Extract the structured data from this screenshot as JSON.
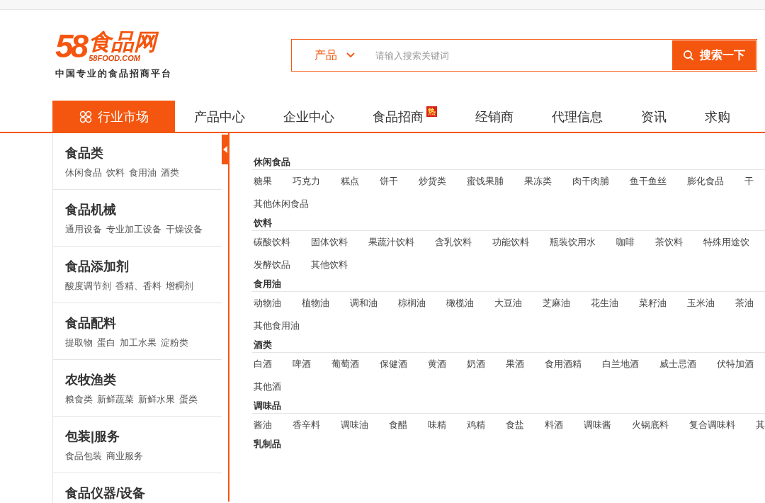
{
  "logo": {
    "number": "58",
    "name": "食品网",
    "domain": "58FOOD.COM",
    "tagline": "中国专业的食品招商平台"
  },
  "search": {
    "category": "产品",
    "placeholder": "请输入搜索关键词",
    "button": "搜索一下"
  },
  "nav": [
    {
      "label": "行业市场",
      "selected": true,
      "hot": false
    },
    {
      "label": "产品中心",
      "selected": false,
      "hot": false
    },
    {
      "label": "企业中心",
      "selected": false,
      "hot": false
    },
    {
      "label": "食品招商",
      "selected": false,
      "hot": true,
      "badge": "热"
    },
    {
      "label": "经销商",
      "selected": false,
      "hot": false
    },
    {
      "label": "代理信息",
      "selected": false,
      "hot": false
    },
    {
      "label": "资讯",
      "selected": false,
      "hot": false
    },
    {
      "label": "求购",
      "selected": false,
      "hot": false
    }
  ],
  "sidebar": [
    {
      "title": "食品类",
      "subs": [
        "休闲食品",
        "饮料",
        "食用油",
        "酒类"
      ]
    },
    {
      "title": "食品机械",
      "subs": [
        "通用设备",
        "专业加工设备",
        "干燥设备"
      ]
    },
    {
      "title": "食品添加剂",
      "subs": [
        "酸度调节剂",
        "香精、香料",
        "增稠剂"
      ]
    },
    {
      "title": "食品配料",
      "subs": [
        "提取物",
        "蛋白",
        "加工水果",
        "淀粉类"
      ]
    },
    {
      "title": "农牧渔类",
      "subs": [
        "粮食类",
        "新鲜蔬菜",
        "新鲜水果",
        "蛋类"
      ]
    },
    {
      "title": "包装|服务",
      "subs": [
        "食品包装",
        "商业服务"
      ]
    },
    {
      "title": "食品仪器/设备"
    }
  ],
  "sections": [
    {
      "title": "休闲食品",
      "rows": [
        [
          "糖果",
          "巧克力",
          "糕点",
          "饼干",
          "炒货类",
          "蜜饯果脯",
          "果冻类",
          "肉干肉脯",
          "鱼干鱼丝",
          "膨化食品",
          "干"
        ],
        [
          "其他休闲食品"
        ]
      ]
    },
    {
      "title": "饮料",
      "rows": [
        [
          "碳酸饮料",
          "固体饮料",
          "果蔬汁饮料",
          "含乳饮料",
          "功能饮料",
          "瓶装饮用水",
          "咖啡",
          "茶饮料",
          "特殊用途饮"
        ],
        [
          "发酵饮品",
          "其他饮料"
        ]
      ]
    },
    {
      "title": "食用油",
      "rows": [
        [
          "动物油",
          "植物油",
          "调和油",
          "棕榈油",
          "橄榄油",
          "大豆油",
          "芝麻油",
          "花生油",
          "菜籽油",
          "玉米油",
          "茶油"
        ],
        [
          "其他食用油"
        ]
      ]
    },
    {
      "title": "酒类",
      "rows": [
        [
          "白酒",
          "啤酒",
          "葡萄酒",
          "保健酒",
          "黄酒",
          "奶酒",
          "果酒",
          "食用酒精",
          "白兰地酒",
          "威士忌酒",
          "伏特加酒"
        ],
        [
          "其他酒"
        ]
      ]
    },
    {
      "title": "调味品",
      "rows": [
        [
          "酱油",
          "香辛料",
          "调味油",
          "食醋",
          "味精",
          "鸡精",
          "食盐",
          "料酒",
          "调味酱",
          "火锅底料",
          "复合调味料",
          "其"
        ]
      ]
    },
    {
      "title": "乳制品"
    }
  ]
}
